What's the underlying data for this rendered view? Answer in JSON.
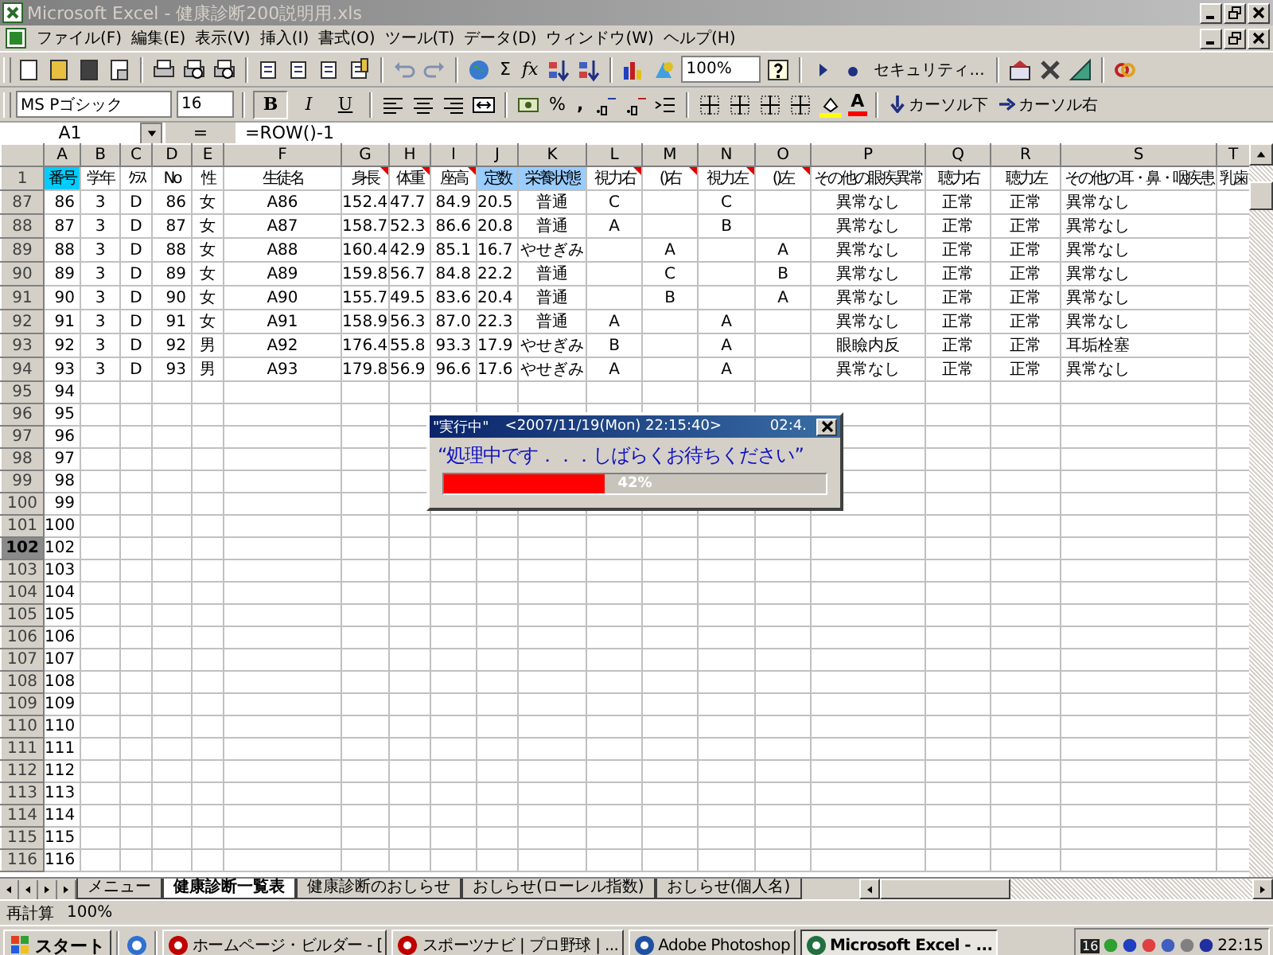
{
  "window": {
    "title": "Microsoft Excel - 健康診断200説明用.xls"
  },
  "menu": [
    {
      "label": "ファイル(F)"
    },
    {
      "label": "編集(E)"
    },
    {
      "label": "表示(V)"
    },
    {
      "label": "挿入(I)"
    },
    {
      "label": "書式(O)"
    },
    {
      "label": "ツール(T)"
    },
    {
      "label": "データ(D)"
    },
    {
      "label": "ウィンドウ(W)"
    },
    {
      "label": "ヘルプ(H)"
    }
  ],
  "toolbar": {
    "autosum": "Σ",
    "function": "fx",
    "zoom": "100%",
    "security": "セキュリティ...",
    "font": "MS Pゴシック",
    "font_size": "16",
    "bold": "B",
    "italic": "I",
    "underline": "U",
    "percent": "%",
    "comma": ",",
    "font_color": "A",
    "cursor_down": "カーソル下",
    "cursor_right": "カーソル右"
  },
  "header_row_number": "1",
  "formula_bar": {
    "name_box": "A1",
    "equals": "=",
    "formula": "=ROW()-1"
  },
  "columns": [
    {
      "letter": "A",
      "header": "番号",
      "color": "#00ccff",
      "comment": false
    },
    {
      "letter": "B",
      "header": "学年",
      "comment": false
    },
    {
      "letter": "C",
      "header": "ｸﾗｽ",
      "comment": false
    },
    {
      "letter": "D",
      "header": "No",
      "comment": false
    },
    {
      "letter": "E",
      "header": "性",
      "comment": false
    },
    {
      "letter": "F",
      "header": "生徒名",
      "comment": false
    },
    {
      "letter": "G",
      "header": "身長",
      "comment": true
    },
    {
      "letter": "H",
      "header": "体重",
      "comment": true
    },
    {
      "letter": "I",
      "header": "座高",
      "comment": true
    },
    {
      "letter": "J",
      "header": "定数",
      "color": "#99ccff",
      "comment": false
    },
    {
      "letter": "K",
      "header": "栄養状態",
      "color": "#99ccff",
      "comment": false
    },
    {
      "letter": "L",
      "header": "視力右",
      "comment": true
    },
    {
      "letter": "M",
      "header": "()右",
      "comment": true
    },
    {
      "letter": "N",
      "header": "視力左",
      "comment": true
    },
    {
      "letter": "O",
      "header": "()左",
      "comment": true
    },
    {
      "letter": "P",
      "header": "その他の眼疾異常",
      "comment": false
    },
    {
      "letter": "Q",
      "header": "聴力右",
      "comment": false
    },
    {
      "letter": "R",
      "header": "聴力左",
      "comment": false
    },
    {
      "letter": "S",
      "header": "その他の耳・鼻・咽疾患",
      "comment": false
    },
    {
      "letter": "T",
      "header": "乳歯",
      "comment": false
    }
  ],
  "rows": [
    {
      "number": "87",
      "selected": false,
      "cells": {
        "A": "86",
        "B": "3",
        "C": "D",
        "D": "86",
        "E": "女",
        "F": "A86",
        "G": "152.4",
        "H": "47.7",
        "I": "84.9",
        "J": "20.5",
        "K": "普通",
        "L": "C",
        "N": "C",
        "P": "異常なし",
        "Q": "正常",
        "R": "正常",
        "S": "異常なし"
      }
    },
    {
      "number": "88",
      "selected": false,
      "cells": {
        "A": "87",
        "B": "3",
        "C": "D",
        "D": "87",
        "E": "女",
        "F": "A87",
        "G": "158.7",
        "H": "52.3",
        "I": "86.6",
        "J": "20.8",
        "K": "普通",
        "L": "A",
        "N": "B",
        "P": "異常なし",
        "Q": "正常",
        "R": "正常",
        "S": "異常なし"
      }
    },
    {
      "number": "89",
      "selected": false,
      "cells": {
        "A": "88",
        "B": "3",
        "C": "D",
        "D": "88",
        "E": "女",
        "F": "A88",
        "G": "160.4",
        "H": "42.9",
        "I": "85.1",
        "J": "16.7",
        "K": "やせぎみ",
        "M": "A",
        "O": "A",
        "P": "異常なし",
        "Q": "正常",
        "R": "正常",
        "S": "異常なし"
      }
    },
    {
      "number": "90",
      "selected": false,
      "cells": {
        "A": "89",
        "B": "3",
        "C": "D",
        "D": "89",
        "E": "女",
        "F": "A89",
        "G": "159.8",
        "H": "56.7",
        "I": "84.8",
        "J": "22.2",
        "K": "普通",
        "M": "C",
        "O": "B",
        "P": "異常なし",
        "Q": "正常",
        "R": "正常",
        "S": "異常なし"
      }
    },
    {
      "number": "91",
      "selected": false,
      "cells": {
        "A": "90",
        "B": "3",
        "C": "D",
        "D": "90",
        "E": "女",
        "F": "A90",
        "G": "155.7",
        "H": "49.5",
        "I": "83.6",
        "J": "20.4",
        "K": "普通",
        "M": "B",
        "O": "A",
        "P": "異常なし",
        "Q": "正常",
        "R": "正常",
        "S": "異常なし"
      }
    },
    {
      "number": "92",
      "selected": false,
      "cells": {
        "A": "91",
        "B": "3",
        "C": "D",
        "D": "91",
        "E": "女",
        "F": "A91",
        "G": "158.9",
        "H": "56.3",
        "I": "87.0",
        "J": "22.3",
        "K": "普通",
        "L": "A",
        "N": "A",
        "P": "異常なし",
        "Q": "正常",
        "R": "正常",
        "S": "異常なし"
      }
    },
    {
      "number": "93",
      "selected": false,
      "cells": {
        "A": "92",
        "B": "3",
        "C": "D",
        "D": "92",
        "E": "男",
        "F": "A92",
        "G": "176.4",
        "H": "55.8",
        "I": "93.3",
        "J": "17.9",
        "K": "やせぎみ",
        "L": "B",
        "N": "A",
        "P": "眼瞼内反",
        "Q": "正常",
        "R": "正常",
        "S": "耳垢栓塞"
      }
    },
    {
      "number": "94",
      "selected": false,
      "cells": {
        "A": "93",
        "B": "3",
        "C": "D",
        "D": "93",
        "E": "男",
        "F": "A93",
        "G": "179.8",
        "H": "56.9",
        "I": "96.6",
        "J": "17.6",
        "K": "やせぎみ",
        "L": "A",
        "N": "A",
        "P": "異常なし",
        "Q": "正常",
        "R": "正常",
        "S": "異常なし"
      }
    },
    {
      "number": "95",
      "selected": false,
      "cells": {
        "A": "94"
      }
    },
    {
      "number": "96",
      "selected": false,
      "cells": {
        "A": "95"
      }
    },
    {
      "number": "97",
      "selected": false,
      "cells": {
        "A": "96"
      }
    },
    {
      "number": "98",
      "selected": false,
      "cells": {
        "A": "97"
      }
    },
    {
      "number": "99",
      "selected": false,
      "cells": {
        "A": "98"
      }
    },
    {
      "number": "100",
      "selected": false,
      "cells": {
        "A": "99"
      }
    },
    {
      "number": "101",
      "selected": false,
      "cells": {
        "A": "100"
      }
    },
    {
      "number": "102",
      "selected": true,
      "cells": {
        "A": "102"
      }
    },
    {
      "number": "103",
      "selected": false,
      "cells": {
        "A": "103"
      }
    },
    {
      "number": "104",
      "selected": false,
      "cells": {
        "A": "104"
      }
    },
    {
      "number": "105",
      "selected": false,
      "cells": {
        "A": "105"
      }
    },
    {
      "number": "106",
      "selected": false,
      "cells": {
        "A": "106"
      }
    },
    {
      "number": "107",
      "selected": false,
      "cells": {
        "A": "107"
      }
    },
    {
      "number": "108",
      "selected": false,
      "cells": {
        "A": "108"
      }
    },
    {
      "number": "109",
      "selected": false,
      "cells": {
        "A": "109"
      }
    },
    {
      "number": "110",
      "selected": false,
      "cells": {
        "A": "110"
      }
    },
    {
      "number": "111",
      "selected": false,
      "cells": {
        "A": "111"
      }
    },
    {
      "number": "112",
      "selected": false,
      "cells": {
        "A": "112"
      }
    },
    {
      "number": "113",
      "selected": false,
      "cells": {
        "A": "113"
      }
    },
    {
      "number": "114",
      "selected": false,
      "cells": {
        "A": "114"
      }
    },
    {
      "number": "115",
      "selected": false,
      "cells": {
        "A": "115"
      }
    },
    {
      "number": "116",
      "selected": false,
      "cells": {
        "A": "116"
      }
    }
  ],
  "dialog": {
    "title": "\"実行中\"",
    "timestamp": "<2007/11/19(Mon) 22:15:40>",
    "elapsed": "02:4.",
    "message": "“処理中です．．．しばらくお待ちください”",
    "progress": {
      "level": 0.42,
      "label": "42%"
    }
  },
  "sheet_tabs": [
    {
      "label": "メニュー",
      "selected": false
    },
    {
      "label": "健康診断一覧表",
      "selected": true
    },
    {
      "label": "健康診断のおしらせ",
      "selected": false
    },
    {
      "label": "おしらせ(ローレル指数)",
      "selected": false
    },
    {
      "label": "おしらせ(個人名)",
      "selected": false
    }
  ],
  "status_bar": {
    "mode": "再計算",
    "zoom": "100%"
  },
  "taskbar": {
    "start": "スタート",
    "tasks": [
      {
        "label": "ホームページ・ビルダー - [",
        "selected": false
      },
      {
        "label": "スポーツナビ | プロ野球 | ...",
        "selected": false
      },
      {
        "label": "Adobe Photoshop",
        "selected": false
      },
      {
        "label": "Microsoft Excel - ...",
        "selected": true
      }
    ],
    "tray_date": "16",
    "clock": "22:15"
  }
}
